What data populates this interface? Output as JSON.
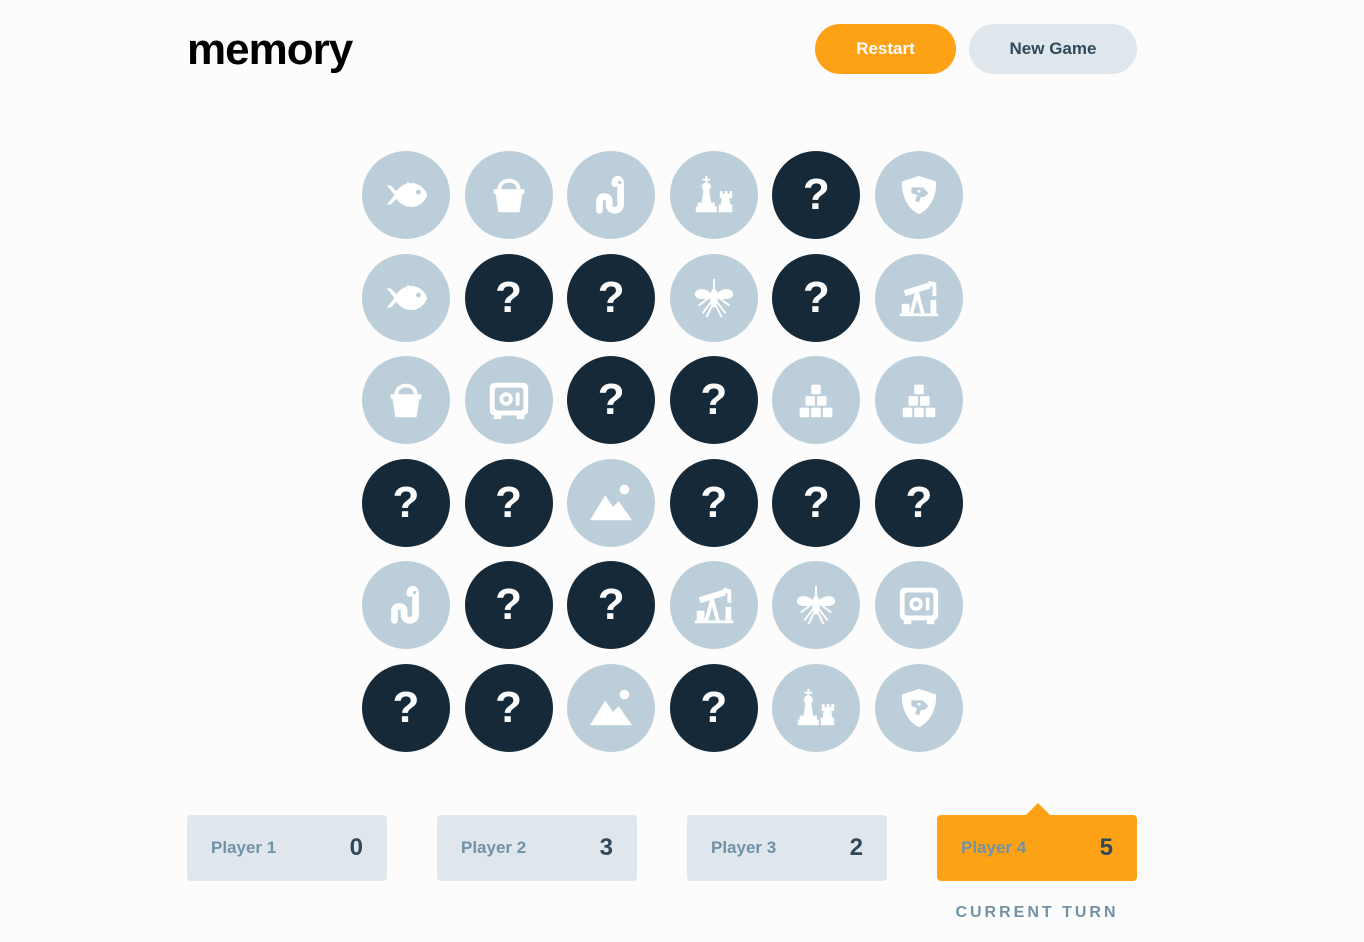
{
  "header": {
    "logo": "memory",
    "restart_label": "Restart",
    "new_game_label": "New Game"
  },
  "colors": {
    "accent": "#FDA214",
    "hidden_tile": "#152938",
    "matched_tile": "#BCCED9",
    "background": "#FCFCFC"
  },
  "board": {
    "rows": [
      [
        {
          "state": "matched",
          "icon": "fish"
        },
        {
          "state": "matched",
          "icon": "bucket"
        },
        {
          "state": "matched",
          "icon": "worm"
        },
        {
          "state": "matched",
          "icon": "chess"
        },
        {
          "state": "hidden",
          "icon": "question"
        },
        {
          "state": "matched",
          "icon": "dog-shield"
        }
      ],
      [
        {
          "state": "matched",
          "icon": "fish"
        },
        {
          "state": "hidden",
          "icon": "question"
        },
        {
          "state": "hidden",
          "icon": "question"
        },
        {
          "state": "matched",
          "icon": "mosquito"
        },
        {
          "state": "hidden",
          "icon": "question"
        },
        {
          "state": "matched",
          "icon": "oil-pump"
        }
      ],
      [
        {
          "state": "matched",
          "icon": "bucket"
        },
        {
          "state": "matched",
          "icon": "safe"
        },
        {
          "state": "hidden",
          "icon": "question"
        },
        {
          "state": "hidden",
          "icon": "question"
        },
        {
          "state": "matched",
          "icon": "cubes"
        },
        {
          "state": "matched",
          "icon": "cubes"
        }
      ],
      [
        {
          "state": "hidden",
          "icon": "question"
        },
        {
          "state": "hidden",
          "icon": "question"
        },
        {
          "state": "matched",
          "icon": "mountain"
        },
        {
          "state": "hidden",
          "icon": "question"
        },
        {
          "state": "hidden",
          "icon": "question"
        },
        {
          "state": "hidden",
          "icon": "question"
        }
      ],
      [
        {
          "state": "matched",
          "icon": "worm"
        },
        {
          "state": "hidden",
          "icon": "question"
        },
        {
          "state": "hidden",
          "icon": "question"
        },
        {
          "state": "matched",
          "icon": "oil-pump"
        },
        {
          "state": "matched",
          "icon": "mosquito"
        },
        {
          "state": "matched",
          "icon": "safe"
        }
      ],
      [
        {
          "state": "hidden",
          "icon": "question"
        },
        {
          "state": "hidden",
          "icon": "question"
        },
        {
          "state": "matched",
          "icon": "mountain"
        },
        {
          "state": "hidden",
          "icon": "question"
        },
        {
          "state": "matched",
          "icon": "chess"
        },
        {
          "state": "matched",
          "icon": "dog-shield"
        }
      ]
    ],
    "hidden_symbol": "?"
  },
  "players": [
    {
      "name": "Player 1",
      "score": "0"
    },
    {
      "name": "Player 2",
      "score": "3"
    },
    {
      "name": "Player 3",
      "score": "2"
    },
    {
      "name": "Player 4",
      "score": "5"
    }
  ],
  "current_turn_label": "CURRENT TURN"
}
